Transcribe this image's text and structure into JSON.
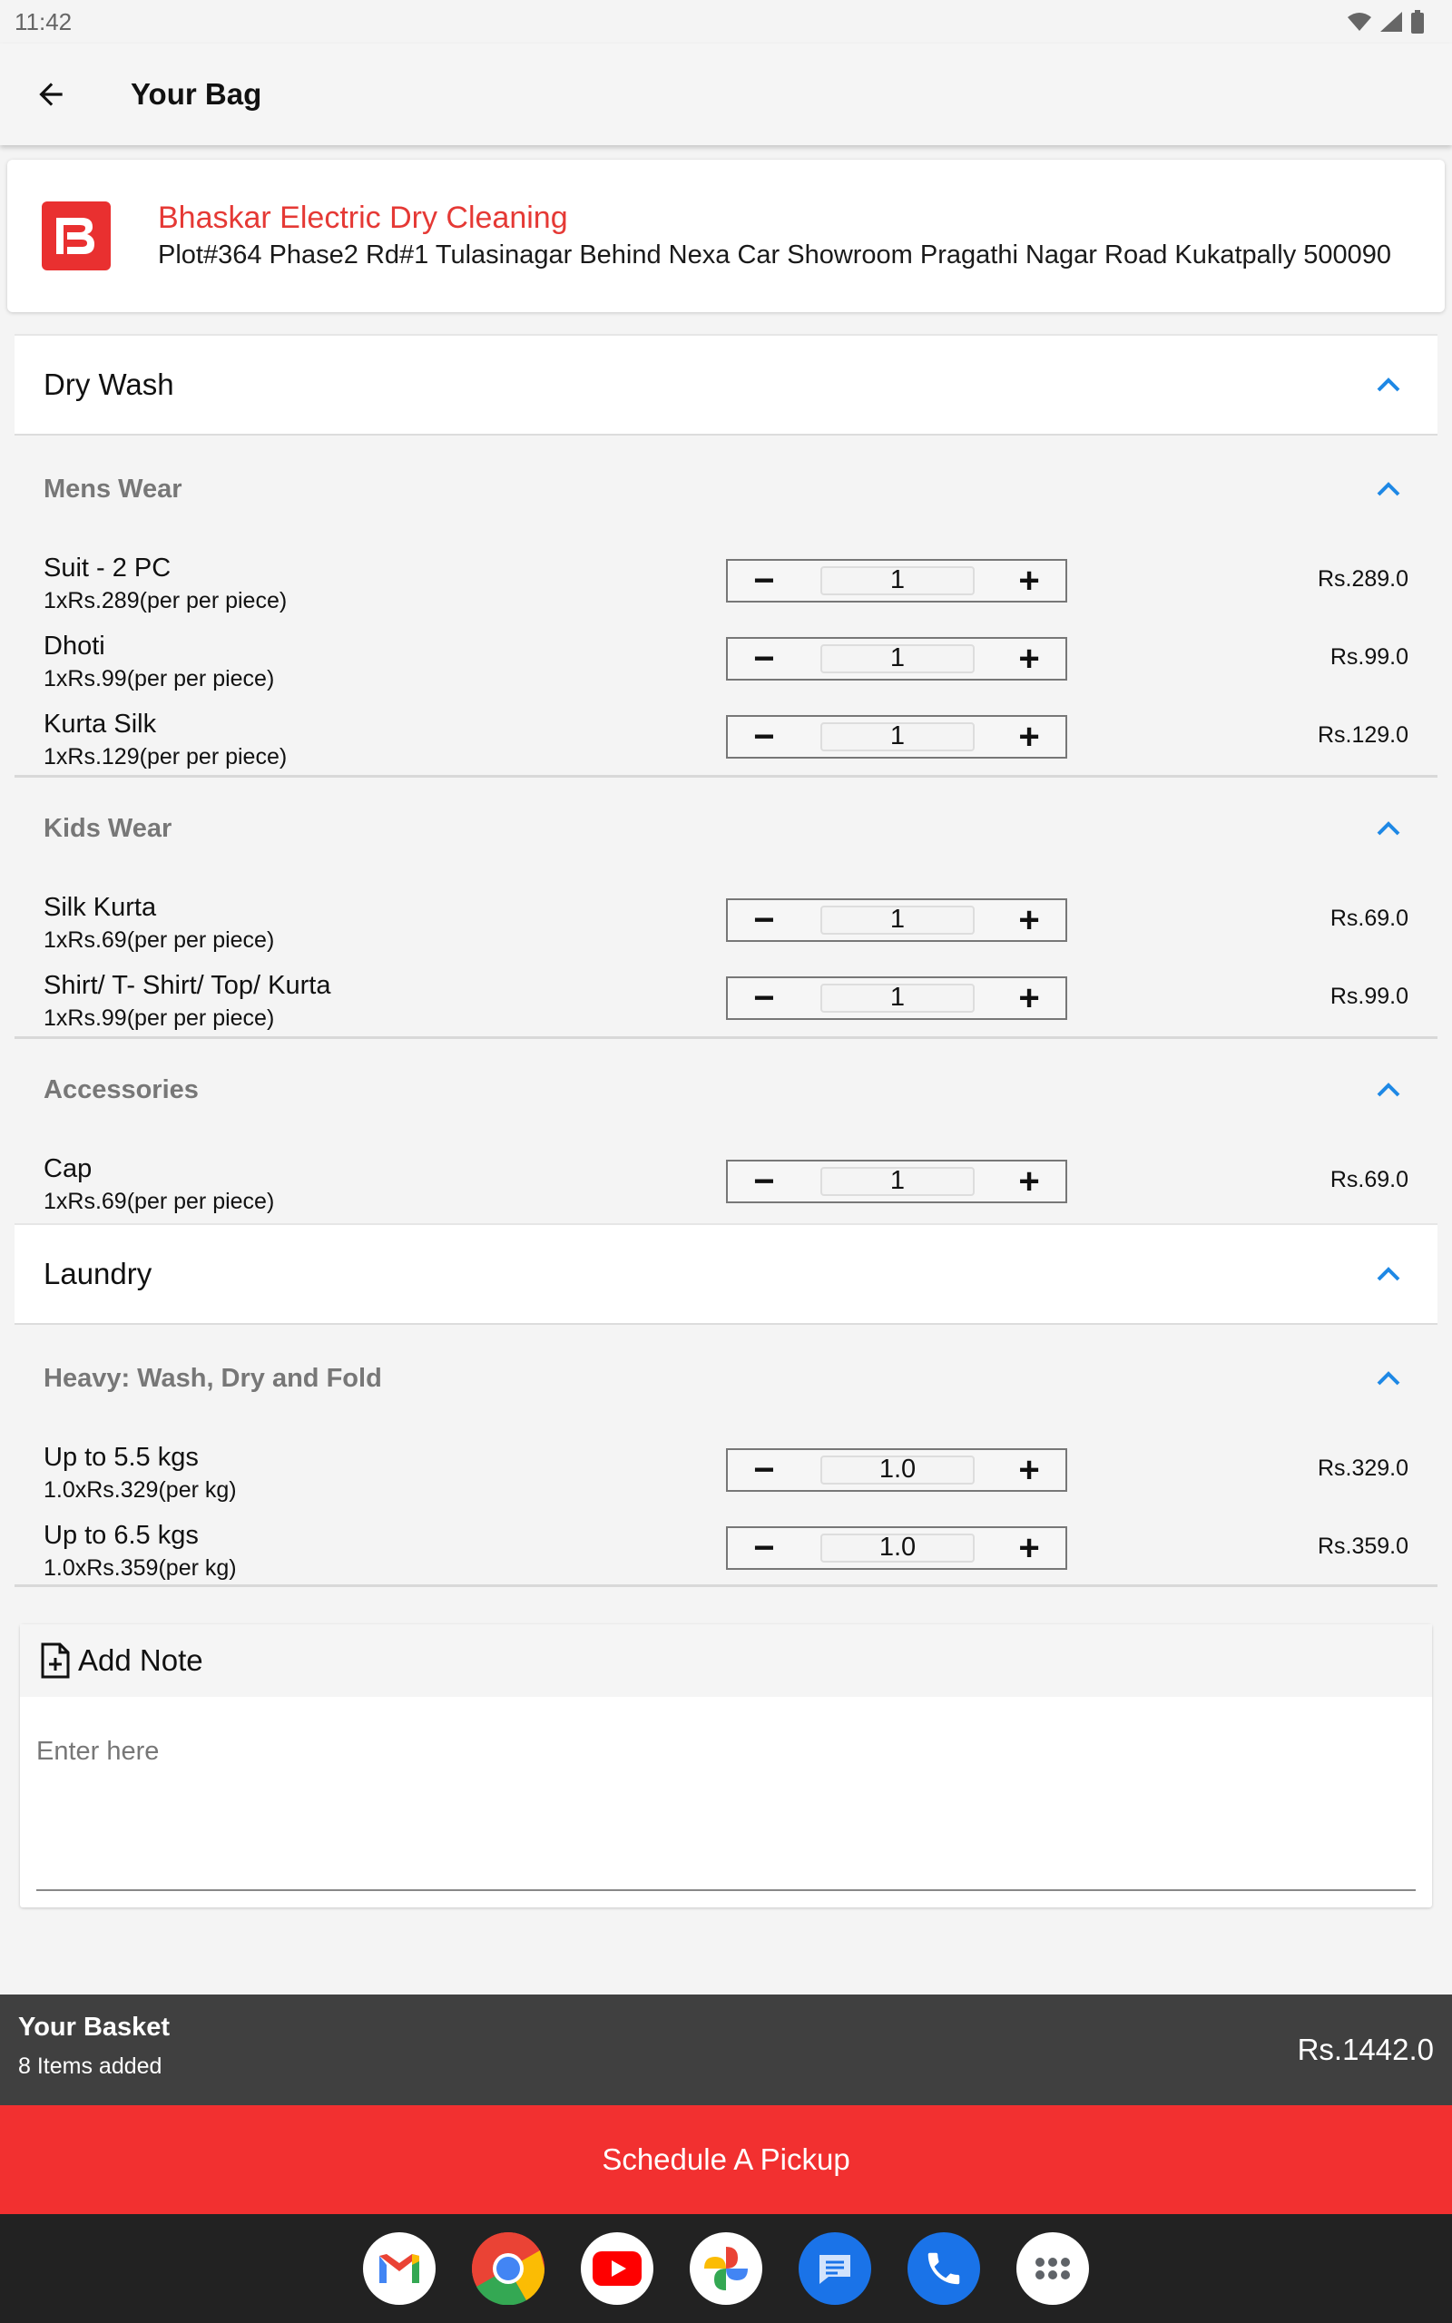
{
  "status": {
    "time": "11:42"
  },
  "header": {
    "title": "Your Bag"
  },
  "shop": {
    "name": "Bhaskar Electric Dry Cleaning",
    "address": "Plot#364 Phase2 Rd#1 Tulasinagar Behind Nexa Car Showroom Pragathi Nagar Road Kukatpally 500090"
  },
  "sections": [
    {
      "title": "Dry Wash",
      "categories": [
        {
          "title": "Mens Wear",
          "items": [
            {
              "name": "Suit - 2 PC",
              "sub": "1xRs.289(per per piece)",
              "qty": "1",
              "price": "Rs.289.0"
            },
            {
              "name": "Dhoti",
              "sub": "1xRs.99(per per piece)",
              "qty": "1",
              "price": "Rs.99.0"
            },
            {
              "name": "Kurta Silk",
              "sub": "1xRs.129(per per piece)",
              "qty": "1",
              "price": "Rs.129.0"
            }
          ]
        },
        {
          "title": "Kids Wear",
          "items": [
            {
              "name": "Silk Kurta",
              "sub": "1xRs.69(per per piece)",
              "qty": "1",
              "price": "Rs.69.0"
            },
            {
              "name": "Shirt/ T- Shirt/ Top/ Kurta",
              "sub": "1xRs.99(per per piece)",
              "qty": "1",
              "price": "Rs.99.0"
            }
          ]
        },
        {
          "title": "Accessories",
          "items": [
            {
              "name": "Cap",
              "sub": "1xRs.69(per per piece)",
              "qty": "1",
              "price": "Rs.69.0"
            }
          ]
        }
      ]
    },
    {
      "title": "Laundry",
      "categories": [
        {
          "title": "Heavy: Wash, Dry and Fold",
          "items": [
            {
              "name": "Up to 5.5 kgs",
              "sub": "1.0xRs.329(per kg)",
              "qty": "1.0",
              "price": "Rs.329.0"
            },
            {
              "name": "Up to 6.5 kgs",
              "sub": "1.0xRs.359(per kg)",
              "qty": "1.0",
              "price": "Rs.359.0"
            }
          ]
        }
      ]
    }
  ],
  "stepper": {
    "minus": "−",
    "plus": "+"
  },
  "note": {
    "title": "Add Note",
    "placeholder": "Enter here"
  },
  "basket": {
    "title": "Your Basket",
    "count": "8 Items added",
    "total": "Rs.1442.0"
  },
  "cta": {
    "label": "Schedule A Pickup"
  },
  "dock": [
    "gmail-icon",
    "chrome-icon",
    "youtube-icon",
    "photos-icon",
    "messages-icon",
    "phone-icon",
    "apps-icon"
  ],
  "colors": {
    "brand": "#e53935",
    "accent": "#1e88e5",
    "basket_bg": "#404040",
    "cta_bg": "#f23030"
  }
}
